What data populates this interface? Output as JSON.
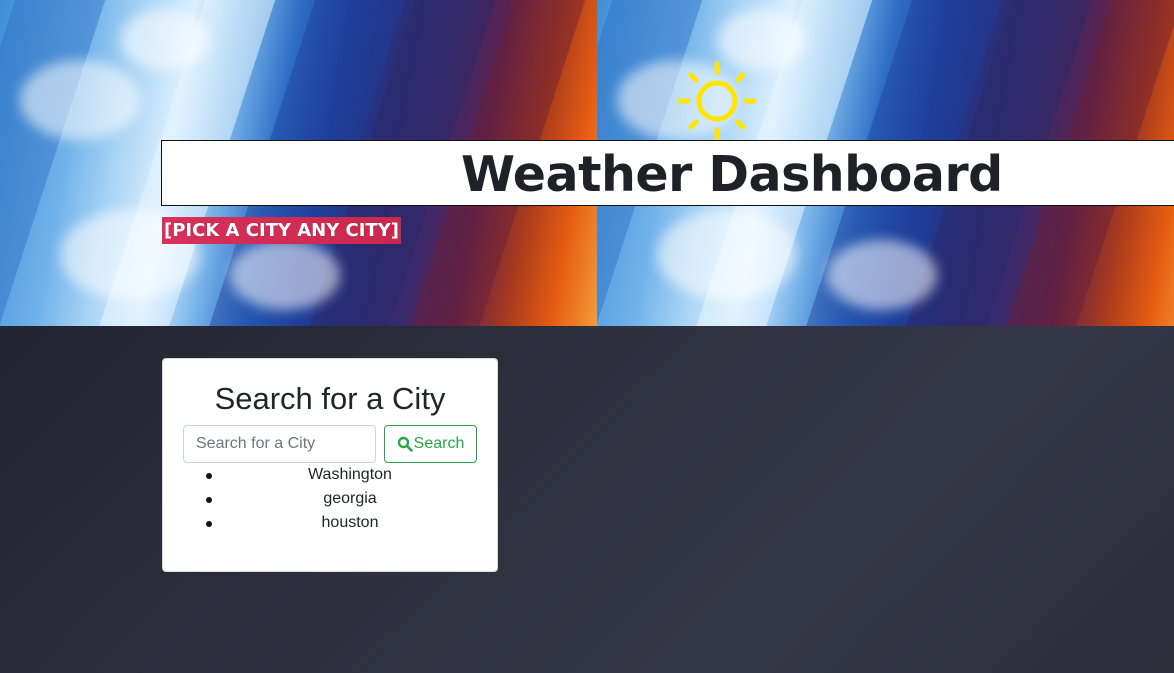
{
  "header": {
    "title": "Weather Dashboard",
    "tagline": "[PICK A CITY ANY CITY]",
    "hero_image": "weather-collage-banner",
    "sun_icon": "sun-icon"
  },
  "search": {
    "heading": "Search for a City",
    "placeholder": "Search for a City",
    "value": "",
    "button_label": "Search",
    "button_icon": "search-icon"
  },
  "history": {
    "cities": [
      "Washington",
      "georgia",
      "houston"
    ]
  },
  "colors": {
    "tagline_bg": "#d8305a",
    "button_accent": "#28a745",
    "sun": "#ffe600",
    "page_bg": "#2a2c3a"
  }
}
